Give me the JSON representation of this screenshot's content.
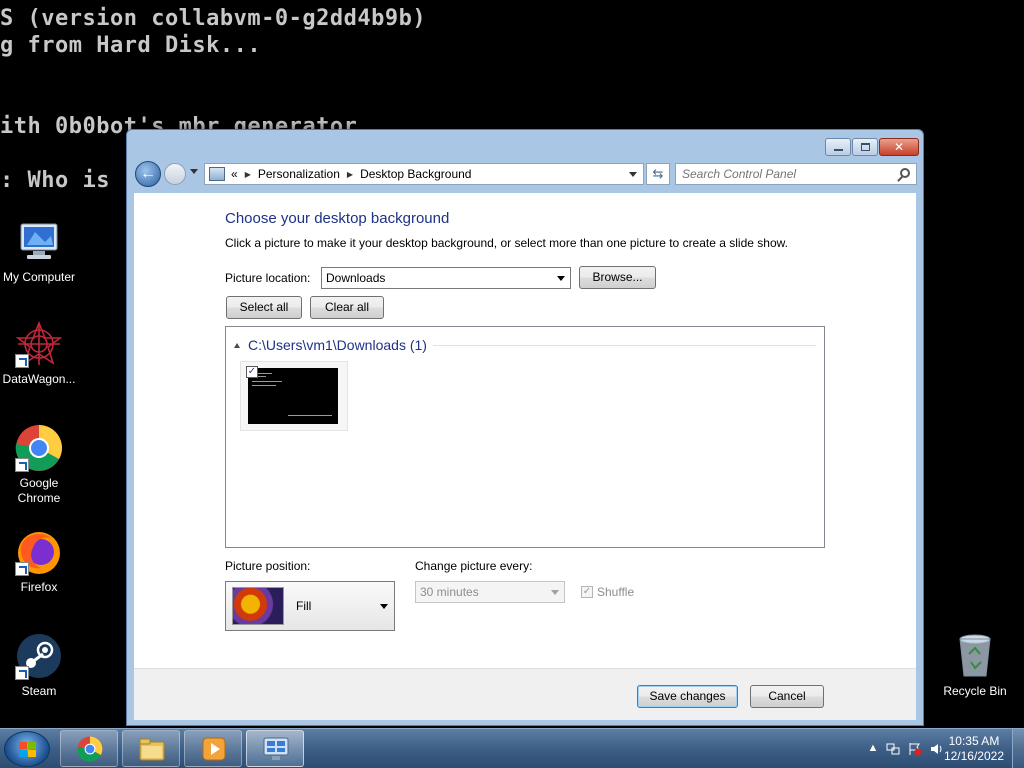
{
  "console": {
    "lines": [
      "S (version collabvm-0-g2dd4b9b)",
      "g from Hard Disk...",
      "",
      "ith 0b0bot's mbr generator",
      ": Who is"
    ]
  },
  "desktop": {
    "icons": [
      {
        "label": "My Computer",
        "icon": "computer-icon"
      },
      {
        "label": "DataWagon...",
        "icon": "datawagon-icon"
      },
      {
        "label": "Google Chrome",
        "icon": "chrome-icon"
      },
      {
        "label": "Firefox",
        "icon": "firefox-icon"
      },
      {
        "label": "Steam",
        "icon": "steam-icon"
      },
      {
        "label": "Recycle Bin",
        "icon": "recycle-bin-icon"
      }
    ]
  },
  "window": {
    "breadcrumb": {
      "overflow": "«",
      "items": [
        "Personalization",
        "Desktop Background"
      ]
    },
    "search_placeholder": "Search Control Panel",
    "heading": "Choose your desktop background",
    "subtext": "Click a picture to make it your desktop background, or select more than one picture to create a slide show.",
    "picture_location": {
      "label": "Picture location:",
      "value": "Downloads",
      "browse_label": "Browse..."
    },
    "select_all_label": "Select all",
    "clear_all_label": "Clear all",
    "gallery": {
      "group_header": "C:\\Users\\vm1\\Downloads (1)",
      "thumbnails": [
        {
          "checked": true
        }
      ]
    },
    "picture_position": {
      "label": "Picture position:",
      "value": "Fill"
    },
    "change_picture": {
      "label": "Change picture every:",
      "value": "30 minutes",
      "shuffle_label": "Shuffle",
      "shuffle_checked": true
    },
    "save_label": "Save changes",
    "cancel_label": "Cancel"
  },
  "taskbar": {
    "time": "10:35 AM",
    "date": "12/16/2022",
    "items": [
      "chrome-icon",
      "explorer-icon",
      "media-player-icon",
      "control-panel-icon"
    ],
    "active_item": "control-panel-icon"
  }
}
